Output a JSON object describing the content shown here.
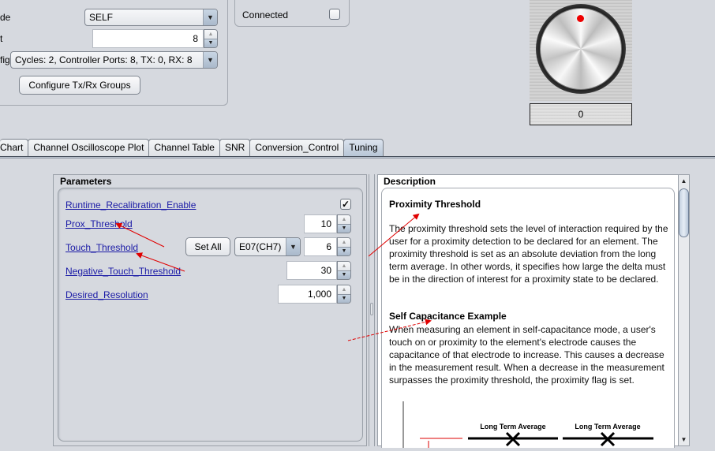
{
  "config": {
    "mode_label": "de",
    "mode_value": "SELF",
    "count_label": "t",
    "count_value": "8",
    "cfg_label": "fig",
    "cfg_value": "Cycles:  2, Controller Ports:  8, TX:  0, RX:  8",
    "configure_button": "Configure Tx/Rx Groups"
  },
  "connection": {
    "label": "Connected",
    "checked": false
  },
  "knob": {
    "value": "0",
    "indicator_color": "#ee0000"
  },
  "tabs": [
    {
      "label": "Chart",
      "active": false
    },
    {
      "label": "Channel Oscilloscope Plot",
      "active": false
    },
    {
      "label": "Channel Table",
      "active": false
    },
    {
      "label": "SNR",
      "active": false
    },
    {
      "label": "Conversion_Control",
      "active": false
    },
    {
      "label": "Tuning",
      "active": true
    }
  ],
  "parameters": {
    "title": "Parameters",
    "runtime_recal": {
      "label": "Runtime_Recalibration_Enable",
      "checked": true,
      "check_glyph": "✓"
    },
    "prox_threshold": {
      "label": "Prox_Threshold",
      "value": "10"
    },
    "touch_threshold": {
      "label": "Touch_Threshold",
      "value": "6",
      "set_all_label": "Set All",
      "channel": "E07(CH7)"
    },
    "negative_touch_threshold": {
      "label": "Negative_Touch_Threshold",
      "value": "30"
    },
    "desired_resolution": {
      "label": "Desired_Resolution",
      "value": "1,000"
    }
  },
  "description": {
    "title": "Description",
    "heading": "Proximity Threshold",
    "paragraph1": "The proximity threshold sets the level of interaction required by the user for a proximity detection to be declared for an element. The proximity threshold is set as an absolute deviation from the long term average. In other words, it specifies how large the delta must be in the direction of interest for a proximity state to be declared.",
    "example_heading": "Self Capacitance Example",
    "paragraph2": "When measuring an element in self-capacitance mode, a user's touch on or proximity to the element's electrode causes the capacitance of that electrode to increase. This causes a decrease in the measurement result. When a decrease in the measurement surpasses the proximity threshold, the proximity flag is set.",
    "figure_labels": [
      "Long Term Average",
      "Long Term Average"
    ]
  },
  "icons": {
    "dropdown": "▼",
    "spin_up": "▲",
    "spin_down": "▼",
    "scroll_up": "▲",
    "scroll_down": "▼"
  },
  "annotation_color": "#e00000"
}
